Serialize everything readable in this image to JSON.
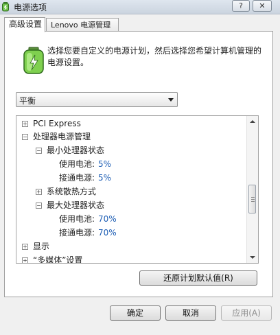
{
  "window": {
    "title": "电源选项",
    "help_button": "?",
    "close_button": "✕"
  },
  "tabs": [
    {
      "label": "高级设置",
      "active": true
    },
    {
      "label": "Lenovo 电源管理",
      "active": false
    }
  ],
  "description": "选择您要自定义的电源计划，然后选择您希望计算机管理的电源设置。",
  "plan_select": {
    "value": "平衡"
  },
  "tree": {
    "rows": [
      {
        "label": "PCI Express",
        "expander": "+",
        "level": 0,
        "value": ""
      },
      {
        "label": "处理器电源管理",
        "expander": "−",
        "level": 0,
        "value": ""
      },
      {
        "label": "最小处理器状态",
        "expander": "−",
        "level": 1,
        "value": ""
      },
      {
        "label": "使用电池:",
        "expander": "",
        "level": 2,
        "value": "5%"
      },
      {
        "label": "接通电源:",
        "expander": "",
        "level": 2,
        "value": "5%"
      },
      {
        "label": "系统散热方式",
        "expander": "+",
        "level": 1,
        "value": ""
      },
      {
        "label": "最大处理器状态",
        "expander": "−",
        "level": 1,
        "value": ""
      },
      {
        "label": "使用电池:",
        "expander": "",
        "level": 2,
        "value": "70%"
      },
      {
        "label": "接通电源:",
        "expander": "",
        "level": 2,
        "value": "70%"
      },
      {
        "label": "显示",
        "expander": "+",
        "level": 0,
        "value": ""
      },
      {
        "label": "“多媒体”设置",
        "expander": "+",
        "level": 0,
        "value": ""
      }
    ]
  },
  "buttons": {
    "restore": "还原计划默认值(R)",
    "ok": "确定",
    "cancel": "取消",
    "apply": "应用(A)"
  },
  "colors": {
    "value_text": "#1f5fb5",
    "title_bar": "#dfe6ef"
  }
}
